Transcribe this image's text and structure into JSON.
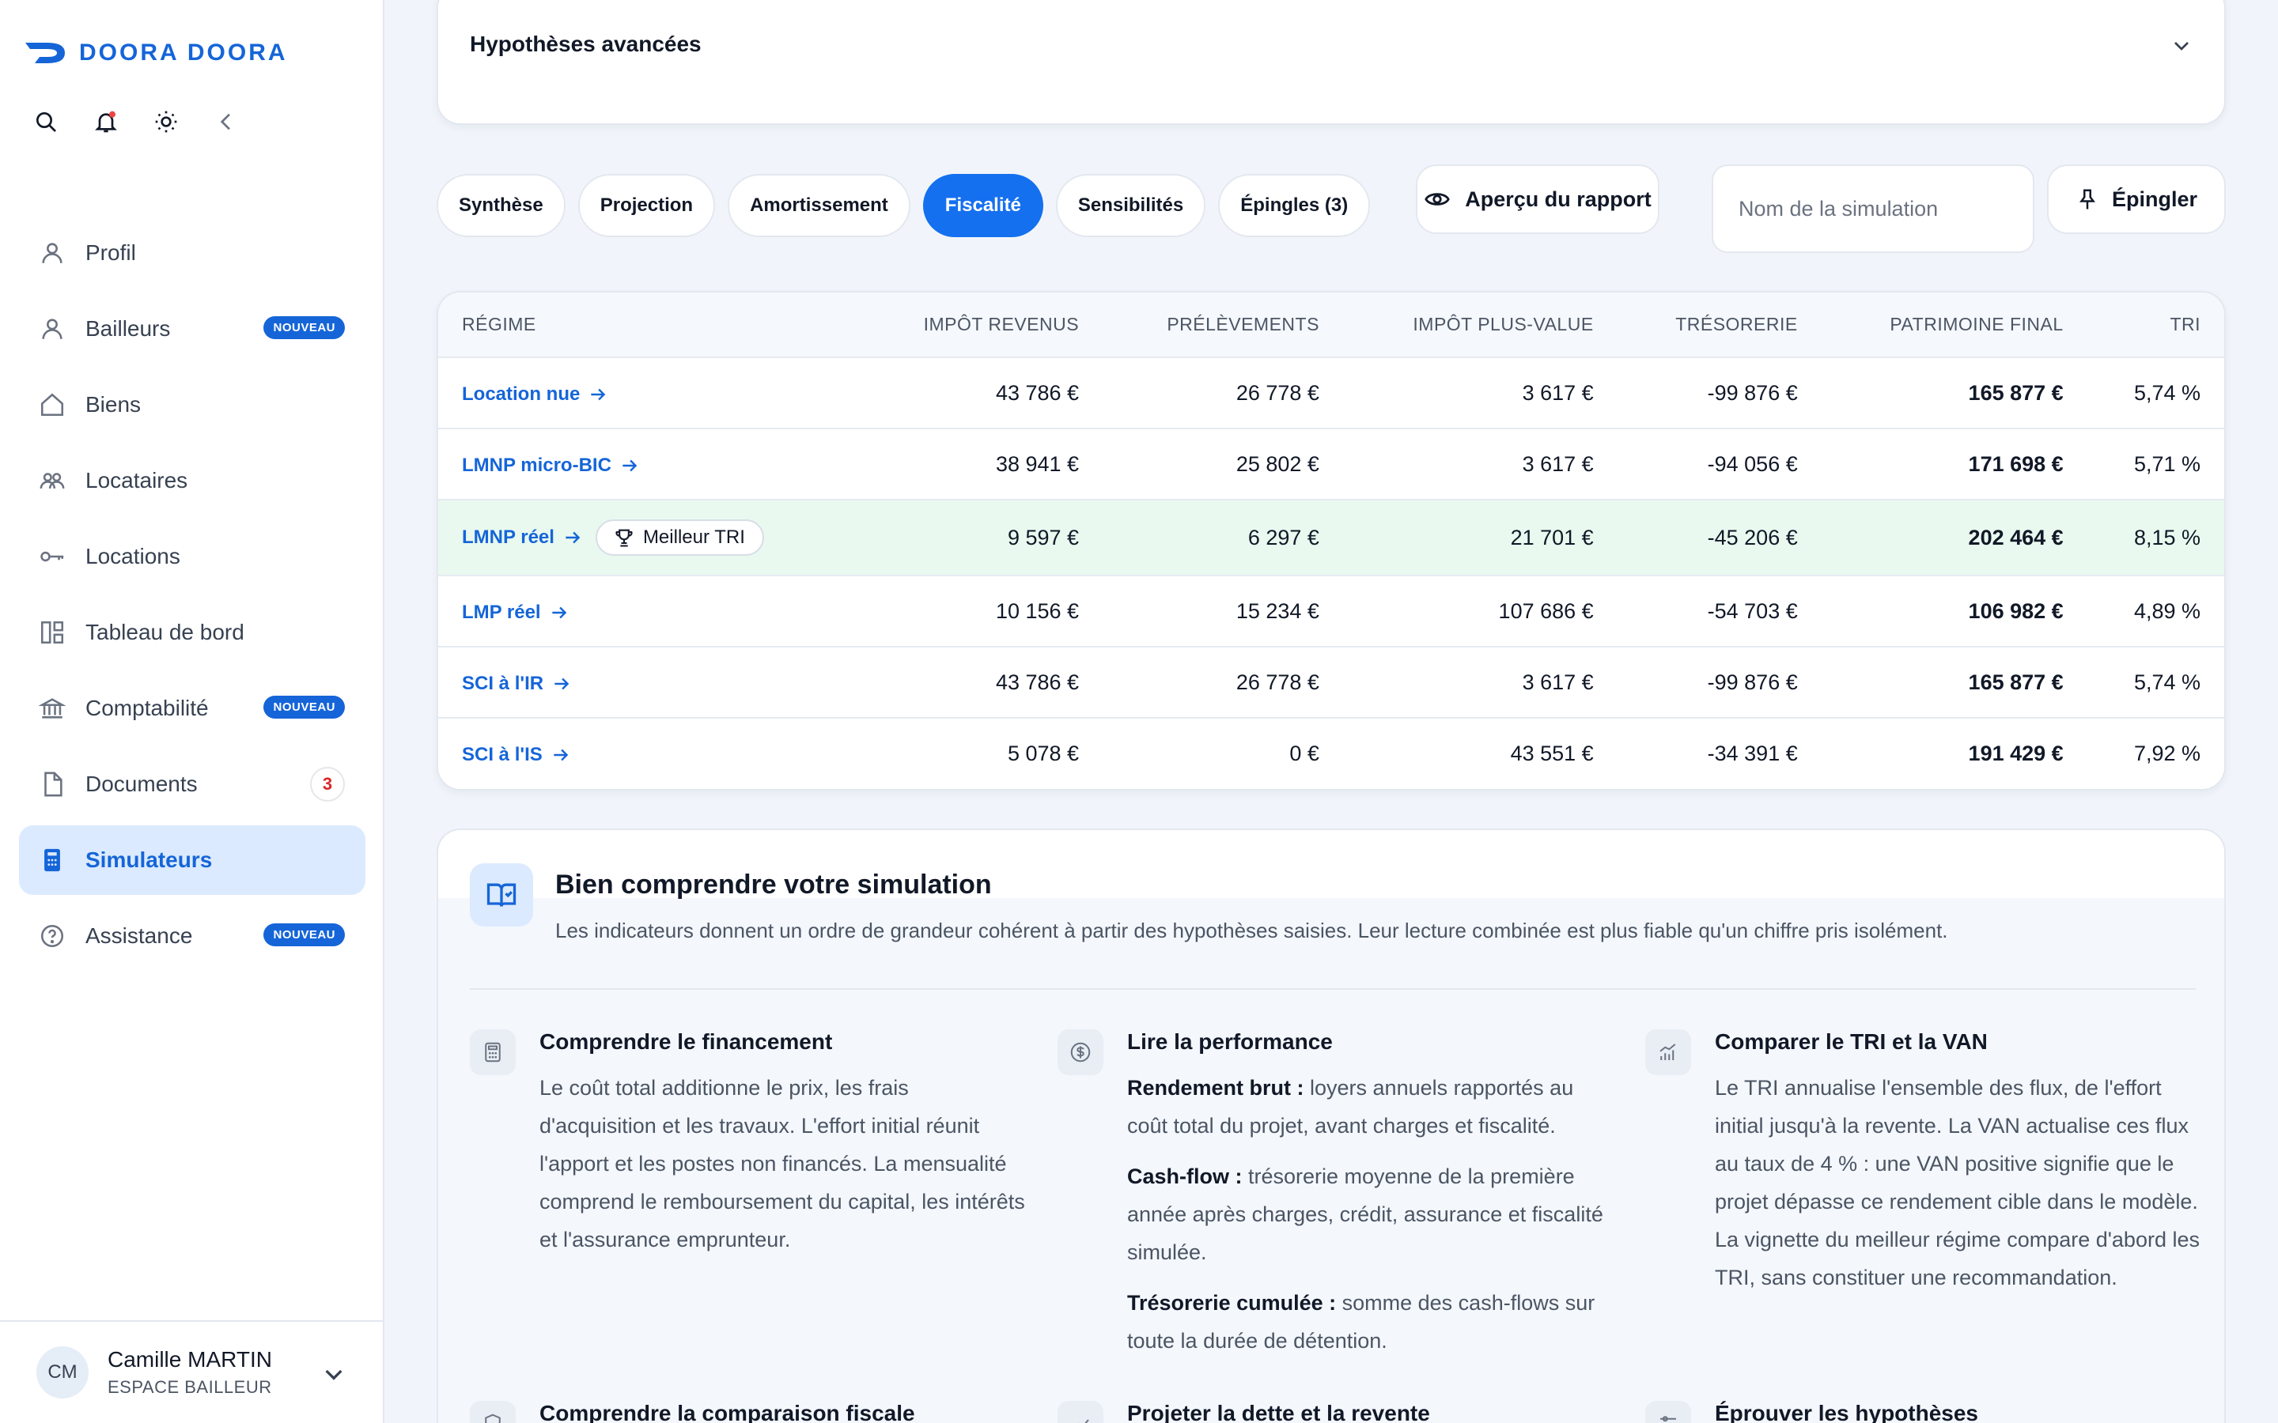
{
  "brand": {
    "name": "DOORA DOORA",
    "color": "#1565d8"
  },
  "sidebar": {
    "tools": [
      {
        "icon": "search-icon"
      },
      {
        "icon": "bell-icon"
      },
      {
        "icon": "sun-icon"
      },
      {
        "icon": "collapse-icon"
      }
    ],
    "items": [
      {
        "label": "Profil",
        "icon": "user-icon"
      },
      {
        "label": "Bailleurs",
        "icon": "user-icon",
        "badge": "NOUVEAU"
      },
      {
        "label": "Biens",
        "icon": "home-icon"
      },
      {
        "label": "Locataires",
        "icon": "users-icon"
      },
      {
        "label": "Locations",
        "icon": "key-icon"
      },
      {
        "label": "Tableau de bord",
        "icon": "dashboard-icon"
      },
      {
        "label": "Comptabilité",
        "icon": "bank-icon",
        "badge": "NOUVEAU"
      },
      {
        "label": "Documents",
        "icon": "file-icon",
        "count": "3"
      },
      {
        "label": "Simulateurs",
        "icon": "calculator-icon",
        "active": true
      },
      {
        "label": "Assistance",
        "icon": "help-icon",
        "badge": "NOUVEAU"
      }
    ],
    "user": {
      "initials": "CM",
      "name": "Camille MARTIN",
      "role": "ESPACE BAILLEUR"
    }
  },
  "advanced": {
    "title": "Hypothèses avancées"
  },
  "tabs": [
    {
      "label": "Synthèse"
    },
    {
      "label": "Projection"
    },
    {
      "label": "Amortissement"
    },
    {
      "label": "Fiscalité",
      "active": true
    },
    {
      "label": "Sensibilités"
    },
    {
      "label": "Épingles (3)"
    }
  ],
  "actions": {
    "preview_label": "Aperçu du rapport",
    "sim_name_placeholder": "Nom de la simulation",
    "pin_label": "Épingler"
  },
  "table": {
    "headers": [
      "RÉGIME",
      "IMPÔT REVENUS",
      "PRÉLÈVEMENTS",
      "IMPÔT PLUS-VALUE",
      "TRÉSORERIE",
      "PATRIMOINE FINAL",
      "TRI"
    ],
    "best_label": "Meilleur TRI",
    "rows": [
      {
        "regime": "Location nue",
        "impot": "43 786 €",
        "prel": "26 778 €",
        "pv": "3 617 €",
        "treso": "-99 876 €",
        "patrimoine": "165 877 €",
        "tri": "5,74 %"
      },
      {
        "regime": "LMNP micro-BIC",
        "impot": "38 941 €",
        "prel": "25 802 €",
        "pv": "3 617 €",
        "treso": "-94 056 €",
        "patrimoine": "171 698 €",
        "tri": "5,71 %"
      },
      {
        "regime": "LMNP réel",
        "best": true,
        "impot": "9 597 €",
        "prel": "6 297 €",
        "pv": "21 701 €",
        "treso": "-45 206 €",
        "patrimoine": "202 464 €",
        "tri": "8,15 %"
      },
      {
        "regime": "LMP réel",
        "impot": "10 156 €",
        "prel": "15 234 €",
        "pv": "107 686 €",
        "treso": "-54 703 €",
        "patrimoine": "106 982 €",
        "tri": "4,89 %"
      },
      {
        "regime": "SCI à l'IR",
        "impot": "43 786 €",
        "prel": "26 778 €",
        "pv": "3 617 €",
        "treso": "-99 876 €",
        "patrimoine": "165 877 €",
        "tri": "5,74 %"
      },
      {
        "regime": "SCI à l'IS",
        "impot": "5 078 €",
        "prel": "0 €",
        "pv": "43 551 €",
        "treso": "-34 391 €",
        "patrimoine": "191 429 €",
        "tri": "7,92 %"
      }
    ]
  },
  "info": {
    "title": "Bien comprendre votre simulation",
    "subtitle": "Les indicateurs donnent un ordre de grandeur cohérent à partir des hypothèses saisies. Leur lecture combinée est plus fiable qu'un chiffre pris isolément.",
    "columns": [
      {
        "icon": "calculator-icon",
        "title": "Comprendre le financement",
        "paragraphs": [
          {
            "text": "Le coût total additionne le prix, les frais d'acquisition et les travaux. L'effort initial réunit l'apport et les postes non financés. La mensualité comprend le remboursement du capital, les intérêts et l'assurance emprunteur."
          }
        ]
      },
      {
        "icon": "dollar-icon",
        "title": "Lire la performance",
        "paragraphs": [
          {
            "strong": "Rendement brut :",
            "text": " loyers annuels rapportés au coût total du projet, avant charges et fiscalité."
          },
          {
            "strong": "Cash-flow :",
            "text": " trésorerie moyenne de la première année après charges, crédit, assurance et fiscalité simulée."
          },
          {
            "strong": "Trésorerie cumulée :",
            "text": " somme des cash-flows sur toute la durée de détention."
          }
        ]
      },
      {
        "icon": "chart-icon",
        "title": "Comparer le TRI et la VAN",
        "paragraphs": [
          {
            "text": "Le TRI annualise l'ensemble des flux, de l'effort initial jusqu'à la revente. La VAN actualise ces flux au taux de 4 % : une VAN positive signifie que le projet dépasse ce rendement cible dans le modèle. La vignette du meilleur régime compare d'abord les TRI, sans constituer une recommandation."
          }
        ]
      }
    ],
    "next_titles": [
      "Comprendre la comparaison fiscale",
      "Projeter la dette et la revente",
      "Éprouver les hypothèses"
    ]
  }
}
